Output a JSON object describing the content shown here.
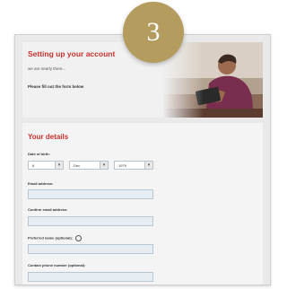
{
  "step_badge": {
    "number": "3"
  },
  "hero": {
    "title": "Setting up your account",
    "subtitle": "we are nearly there...",
    "instruction": "Please fill out the form below"
  },
  "details": {
    "title": "Your details",
    "dob": {
      "label": "Date of birth:",
      "day": "6",
      "month": "Dec",
      "year": "1979"
    },
    "email_label": "Email address:",
    "confirm_email_label": "Confirm email address:",
    "preferred_name_label": "Preferred name (optional):",
    "contact_phone_label": "Contact phone number (optional):"
  },
  "colors": {
    "accent": "#c8322f",
    "badge": "#b49c5e",
    "input_bg": "#e7eef3"
  },
  "icons": {
    "select_arrow": "chevron-down-icon",
    "help": "help-icon"
  }
}
